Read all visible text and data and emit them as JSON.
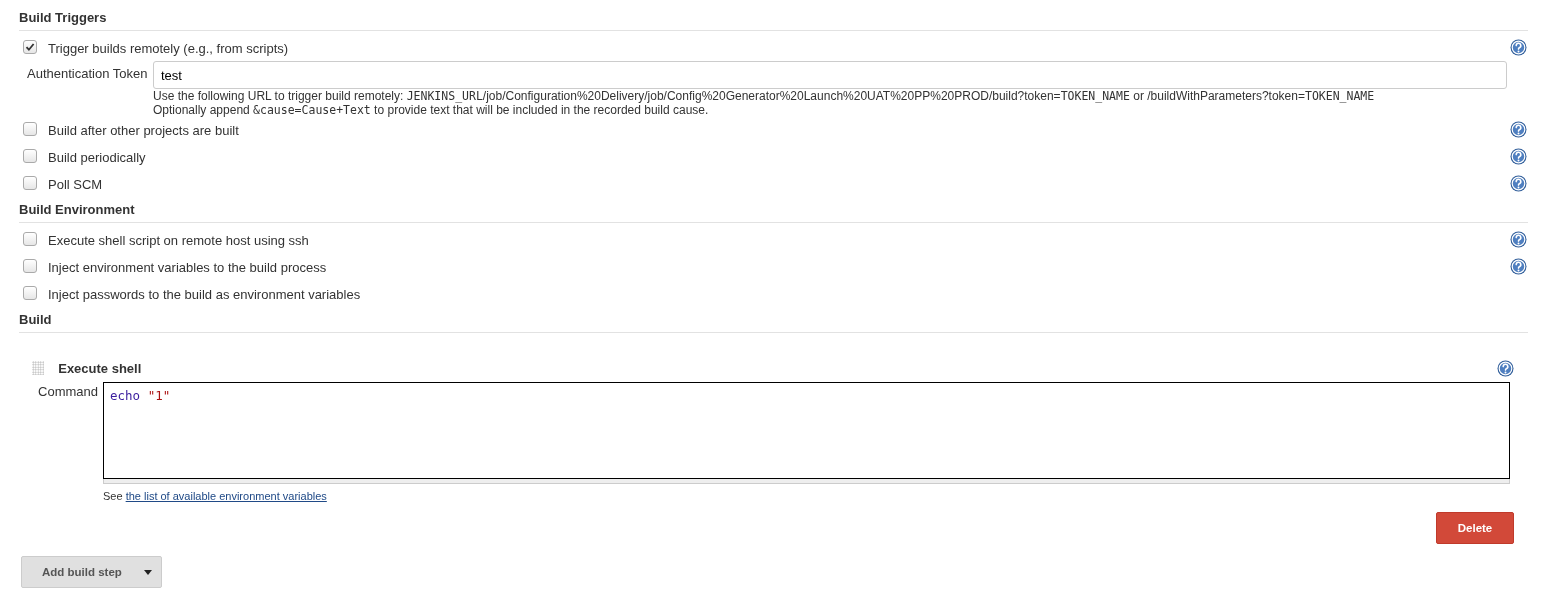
{
  "sections": [
    {
      "title": "Build Triggers",
      "options": [
        {
          "label": "Trigger builds remotely (e.g., from scripts)",
          "checked": true,
          "help": true,
          "field": {
            "label": "Authentication Token",
            "value": "test",
            "help_lines": [
              [
                {
                  "kind": "text",
                  "text": "Use the following URL to trigger build remotely: "
                },
                {
                  "kind": "code",
                  "text": "JENKINS_URL"
                },
                {
                  "kind": "text",
                  "text": "/job/Configuration%20Delivery/job/Config%20Generator%20Launch%20UAT%20PP%20PROD/build?token="
                },
                {
                  "kind": "code",
                  "text": "TOKEN_NAME"
                },
                {
                  "kind": "text",
                  "text": " or /buildWithParameters?token="
                },
                {
                  "kind": "code",
                  "text": "TOKEN_NAME"
                }
              ],
              [
                {
                  "kind": "text",
                  "text": "Optionally append "
                },
                {
                  "kind": "code",
                  "text": "&cause=Cause+Text"
                },
                {
                  "kind": "text",
                  "text": " to provide text that will be included in the recorded build cause."
                }
              ]
            ]
          }
        },
        {
          "label": "Build after other projects are built",
          "checked": false,
          "help": true
        },
        {
          "label": "Build periodically",
          "checked": false,
          "help": true
        },
        {
          "label": "Poll SCM",
          "checked": false,
          "help": true
        }
      ]
    },
    {
      "title": "Build Environment",
      "options": [
        {
          "label": "Execute shell script on remote host using ssh",
          "checked": false,
          "help": true
        },
        {
          "label": "Inject environment variables to the build process",
          "checked": false,
          "help": true
        },
        {
          "label": "Inject passwords to the build as environment variables",
          "checked": false,
          "help": false
        }
      ]
    },
    {
      "title": "Build",
      "steps": [
        {
          "title": "Execute shell",
          "field_label": "Command",
          "command": [
            {
              "kind": "keyword",
              "text": "echo"
            },
            {
              "kind": "string",
              "text": "\"1\""
            }
          ],
          "see": "See",
          "link": "the list of available environment variables",
          "delete": "Delete"
        }
      ]
    }
  ],
  "add_button": "Add build step"
}
